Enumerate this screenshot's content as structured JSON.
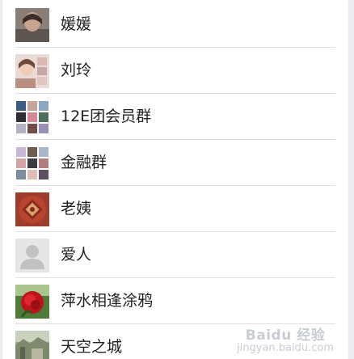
{
  "contacts": [
    {
      "name": "媛媛",
      "avatar": "portrait-photo-avatar"
    },
    {
      "name": "刘玲",
      "avatar": "portrait-photo-avatar"
    },
    {
      "name": "12E团会员群",
      "avatar": "group-mosaic-avatar"
    },
    {
      "name": "金融群",
      "avatar": "group-mosaic-avatar"
    },
    {
      "name": "老姨",
      "avatar": "red-papercut-avatar"
    },
    {
      "name": "爱人",
      "avatar": "default-person-avatar"
    },
    {
      "name": "萍水相逢涂鸦",
      "avatar": "red-rose-avatar"
    },
    {
      "name": "天空之城",
      "avatar": "landscape-photo-avatar"
    }
  ],
  "watermark": {
    "brand": "Baidu 经验",
    "url": "jingyan.baidu.com"
  },
  "colors": {
    "background": "#ececf0",
    "panel": "#ffffff",
    "divider": "#e1e1e1",
    "text": "#222222"
  }
}
